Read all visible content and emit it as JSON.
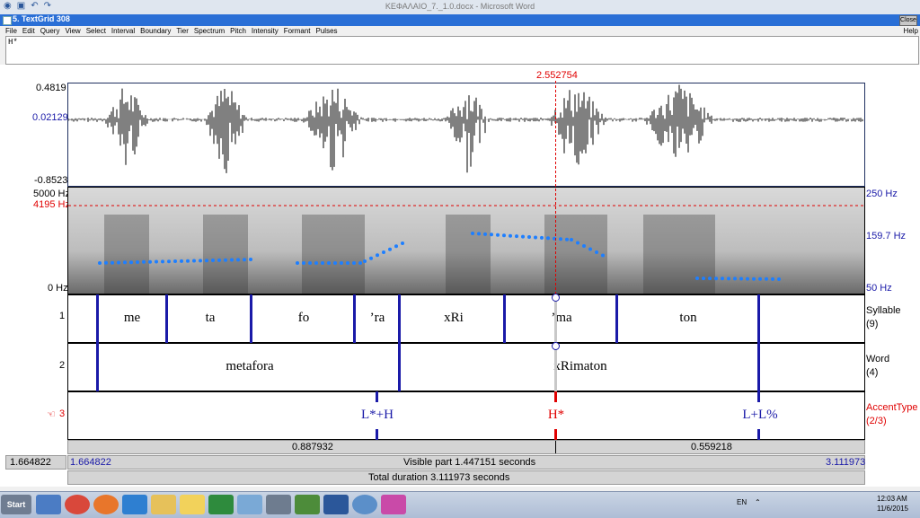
{
  "word_window": {
    "title": "ΚΕΦΑΛΑΙΟ_7._1.0.docx - Microsoft Word"
  },
  "praat_window": {
    "title": "5. TextGrid 308",
    "close_label": "Close",
    "menu": [
      "File",
      "Edit",
      "Query",
      "View",
      "Select",
      "Interval",
      "Boundary",
      "Tier",
      "Spectrum",
      "Pitch",
      "Intensity",
      "Formant",
      "Pulses"
    ],
    "help_label": "Help",
    "text_value": "H*"
  },
  "cursor_time": "2.552754",
  "waveform": {
    "max": "0.4819",
    "mid": "0.02129",
    "min": "-0.8523"
  },
  "spectrogram": {
    "freq_top": "5000 Hz",
    "freq_cursor": "4195 Hz",
    "freq_bottom": "0 Hz",
    "pitch_top": "250 Hz",
    "pitch_mid": "159.7 Hz",
    "pitch_bottom": "50 Hz"
  },
  "tiers": [
    {
      "number": "1",
      "name": "Syllable",
      "count": "(9)",
      "intervals": [
        "me",
        "ta",
        "fo",
        "’ra",
        "xRi",
        "’ma",
        "ton"
      ]
    },
    {
      "number": "2",
      "name": "Word",
      "count": "(4)",
      "intervals": [
        "metafora",
        "xRimaton"
      ]
    },
    {
      "number": "3",
      "name": "AccentType",
      "count": "(2/3)",
      "points": [
        "L*+H",
        "H*",
        "L+L%"
      ]
    }
  ],
  "selection": {
    "left_duration": "0.887932",
    "right_duration": "0.559218"
  },
  "time_bar": {
    "window_start": "1.664822",
    "visible_start": "1.664822",
    "visible_label": "Visible part 1.447151 seconds",
    "visible_end": "3.111973",
    "total_label": "Total duration 3.111973 seconds"
  },
  "taskbar": {
    "start_label": "Start",
    "language": "EN",
    "time": "12:03 AM",
    "date": "11/6/2015"
  },
  "colors": {
    "praat_blue": "#1a1aa8",
    "cursor_red": "#e00000",
    "pitch_dots": "#1e7fff"
  }
}
